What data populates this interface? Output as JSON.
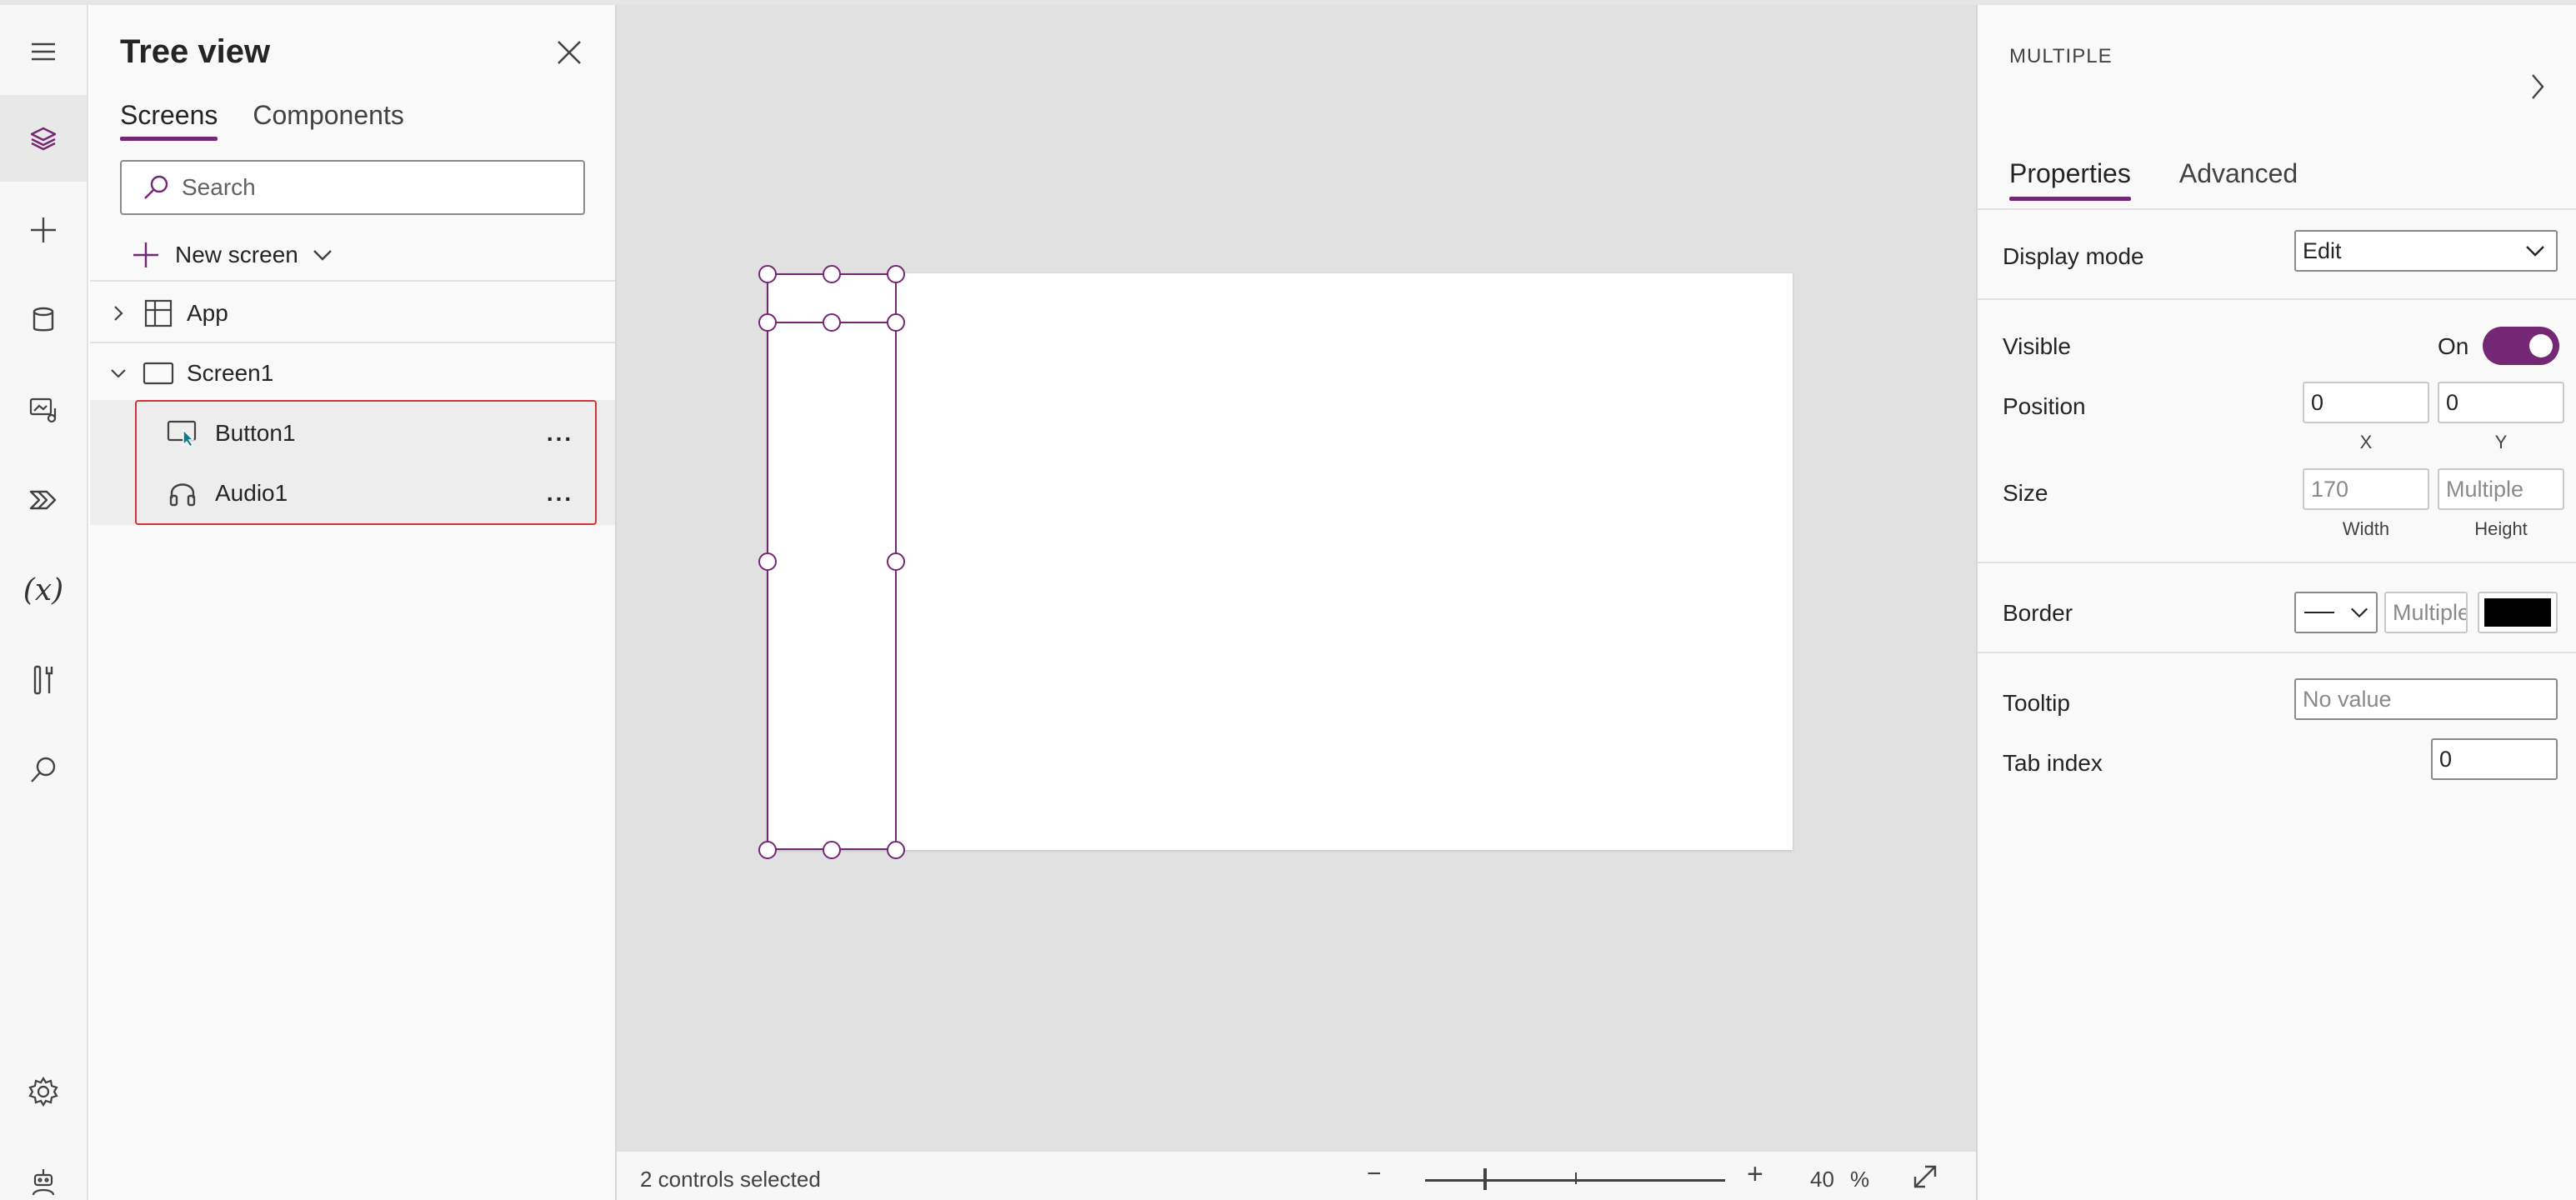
{
  "tree_view": {
    "title": "Tree view",
    "tabs": [
      {
        "label": "Screens",
        "active": true
      },
      {
        "label": "Components",
        "active": false
      }
    ],
    "search": {
      "placeholder": "Search"
    },
    "new_screen": {
      "label": "New screen"
    },
    "nodes": [
      {
        "label": "App",
        "icon": "app-grid-icon",
        "expanded": false
      },
      {
        "label": "Screen1",
        "icon": "screen-icon",
        "expanded": true
      }
    ],
    "children": [
      {
        "label": "Button1",
        "icon": "button-icon",
        "more": "..."
      },
      {
        "label": "Audio1",
        "icon": "headphones-icon",
        "more": "..."
      }
    ]
  },
  "rail": {
    "items": [
      "menu-icon",
      "layers-icon",
      "plus-icon",
      "database-icon",
      "media-icon",
      "power-automate-icon",
      "variables-icon",
      "tools-icon",
      "search-icon",
      "settings-icon",
      "virtual-agent-icon"
    ],
    "variables_glyph": "(x)"
  },
  "status_bar": {
    "status": "2 controls selected",
    "zoom_minus": "−",
    "zoom_plus": "+",
    "zoom_value": "40",
    "zoom_unit": "%",
    "zoom_percent": 40
  },
  "properties": {
    "header": "MULTIPLE",
    "tabs": [
      {
        "label": "Properties",
        "active": true
      },
      {
        "label": "Advanced",
        "active": false
      }
    ],
    "display_mode": {
      "label": "Display mode",
      "value": "Edit"
    },
    "visible": {
      "label": "Visible",
      "value": "On",
      "on": true
    },
    "position": {
      "label": "Position",
      "x": "0",
      "y": "0",
      "x_label": "X",
      "y_label": "Y"
    },
    "size": {
      "label": "Size",
      "width": "170",
      "height": "Multiple",
      "width_label": "Width",
      "height_label": "Height"
    },
    "border": {
      "label": "Border",
      "thickness": "Multiple",
      "color": "#000000"
    },
    "tooltip": {
      "label": "Tooltip",
      "placeholder": "No value"
    },
    "tab_index": {
      "label": "Tab index",
      "value": "0"
    }
  },
  "colors": {
    "accent": "#742774",
    "selection_outline": "#d13438"
  }
}
